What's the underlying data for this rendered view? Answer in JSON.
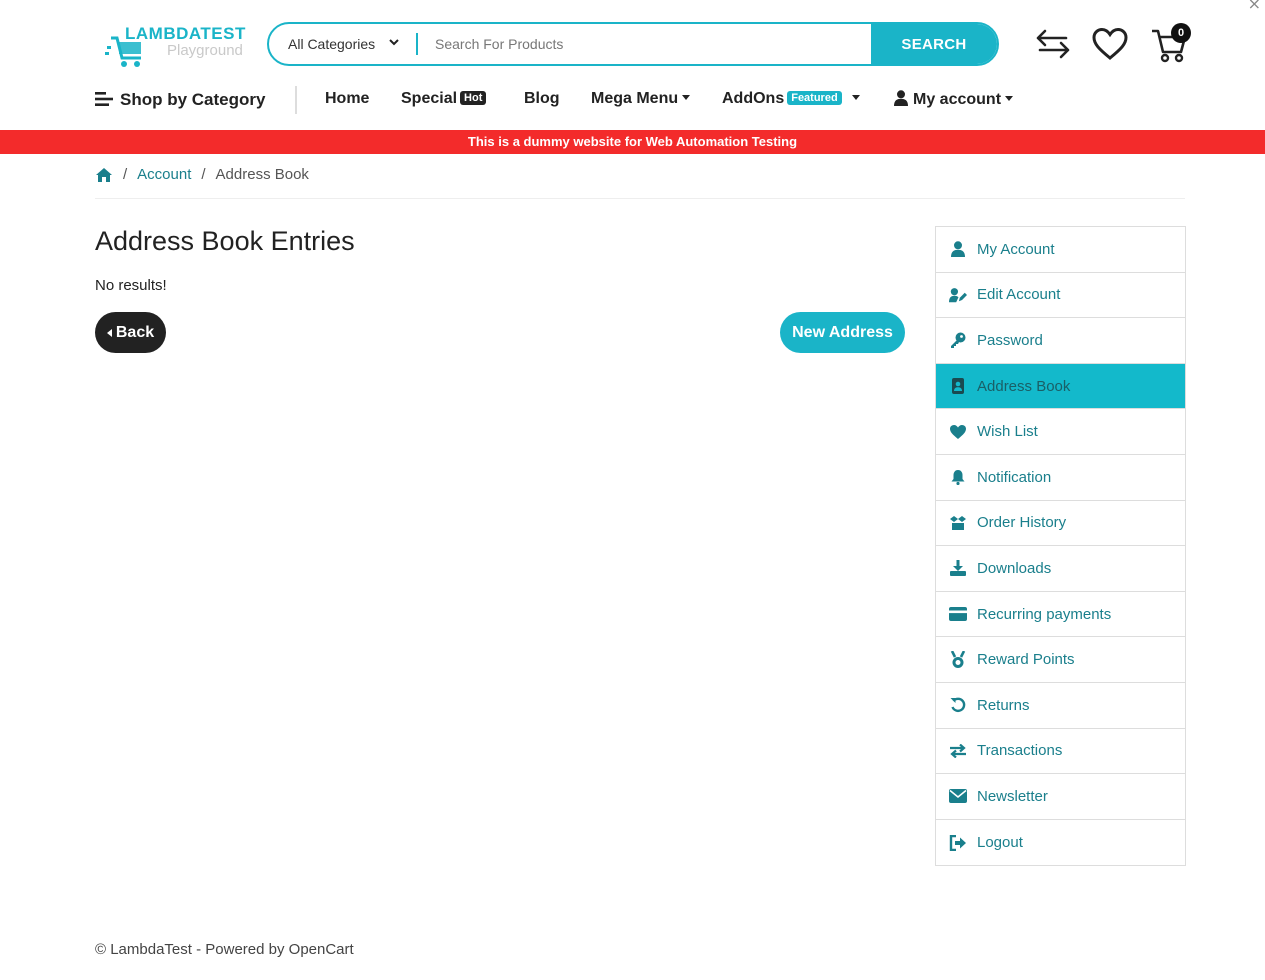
{
  "header": {
    "logo_brand": "LAMBDATEST",
    "logo_sub": "Playground",
    "search_category": "All Categories",
    "search_placeholder": "Search For Products",
    "search_button": "SEARCH",
    "cart_count": "0"
  },
  "nav": {
    "shop_by_category": "Shop by Category",
    "home": "Home",
    "special": "Special",
    "special_badge": "Hot",
    "blog": "Blog",
    "mega_menu": "Mega Menu",
    "addons": "AddOns",
    "addons_badge": "Featured",
    "my_account": "My account"
  },
  "notice": "This is a dummy website for Web Automation Testing",
  "breadcrumb": {
    "account": "Account",
    "current": "Address Book",
    "sep": "/"
  },
  "main": {
    "title": "Address Book Entries",
    "empty_text": "No results!",
    "back_label": "Back",
    "new_address_label": "New Address"
  },
  "sidebar": {
    "items": [
      {
        "label": "My Account",
        "icon": "user-icon"
      },
      {
        "label": "Edit Account",
        "icon": "user-edit-icon"
      },
      {
        "label": "Password",
        "icon": "key-icon"
      },
      {
        "label": "Address Book",
        "icon": "address-book-icon",
        "active": true
      },
      {
        "label": "Wish List",
        "icon": "heart-icon"
      },
      {
        "label": "Notification",
        "icon": "bell-icon"
      },
      {
        "label": "Order History",
        "icon": "box-icon"
      },
      {
        "label": "Downloads",
        "icon": "download-icon"
      },
      {
        "label": "Recurring payments",
        "icon": "credit-card-icon"
      },
      {
        "label": "Reward Points",
        "icon": "medal-icon"
      },
      {
        "label": "Returns",
        "icon": "undo-icon"
      },
      {
        "label": "Transactions",
        "icon": "exchange-icon"
      },
      {
        "label": "Newsletter",
        "icon": "envelope-icon"
      },
      {
        "label": "Logout",
        "icon": "sign-out-icon"
      }
    ]
  },
  "footer": "© LambdaTest - Powered by OpenCart",
  "colors": {
    "accent": "#1ab4c8",
    "notice_red": "#f32b2b",
    "link": "#1a7f8c",
    "dark": "#222222"
  }
}
